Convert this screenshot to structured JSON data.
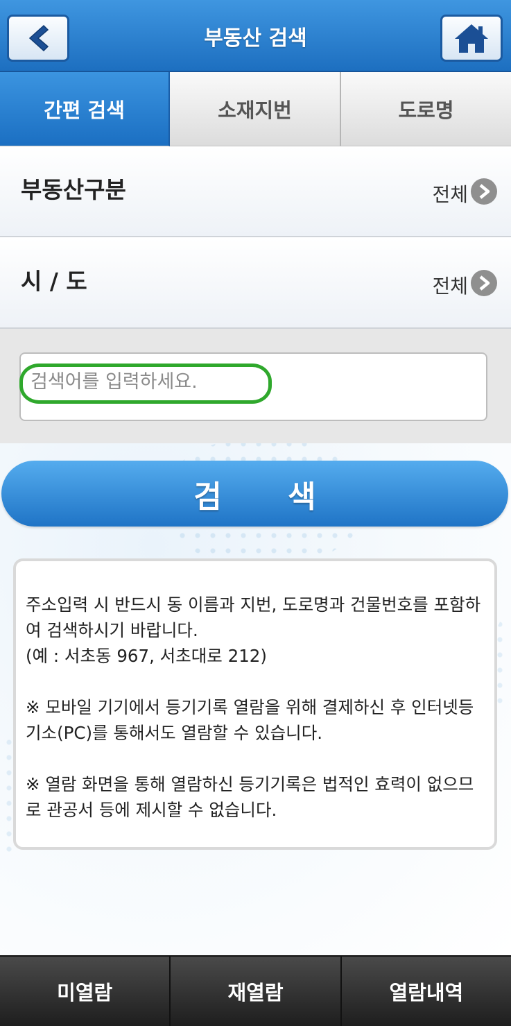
{
  "header": {
    "title": "부동산 검색",
    "back_icon": "back-arrow-icon",
    "home_icon": "home-icon"
  },
  "tabs": [
    {
      "label": "간편 검색",
      "active": true
    },
    {
      "label": "소재지번",
      "active": false
    },
    {
      "label": "도로명",
      "active": false
    }
  ],
  "filters": {
    "property_type": {
      "label": "부동산구분",
      "value": "전체"
    },
    "region": {
      "label": "시 / 도",
      "value": "전체"
    }
  },
  "search": {
    "placeholder": "검색어를 입력하세요.",
    "button_label": "검 색"
  },
  "notice": {
    "paragraphs": [
      "주소입력 시 반드시 동 이름과 지번, 도로명과 건물번호를 포함하여 검색하시기 바랍니다.\n(예 : 서초동 967, 서초대로 212)",
      "※ 모바일 기기에서 등기기록 열람을 위해 결제하신 후 인터넷등기소(PC)를 통해서도 열람할 수 있습니다.",
      "※ 열람 화면을 통해 열람하신 등기기록은 법적인 효력이 없으므로 관공서 등에 제시할 수 없습니다."
    ]
  },
  "bottom_nav": [
    {
      "label": "미열람"
    },
    {
      "label": "재열람"
    },
    {
      "label": "열람내역"
    }
  ],
  "colors": {
    "primary_blue": "#1d6fc0",
    "highlight_green": "#2fa82c",
    "bottom_bar": "#1e1e1e"
  }
}
